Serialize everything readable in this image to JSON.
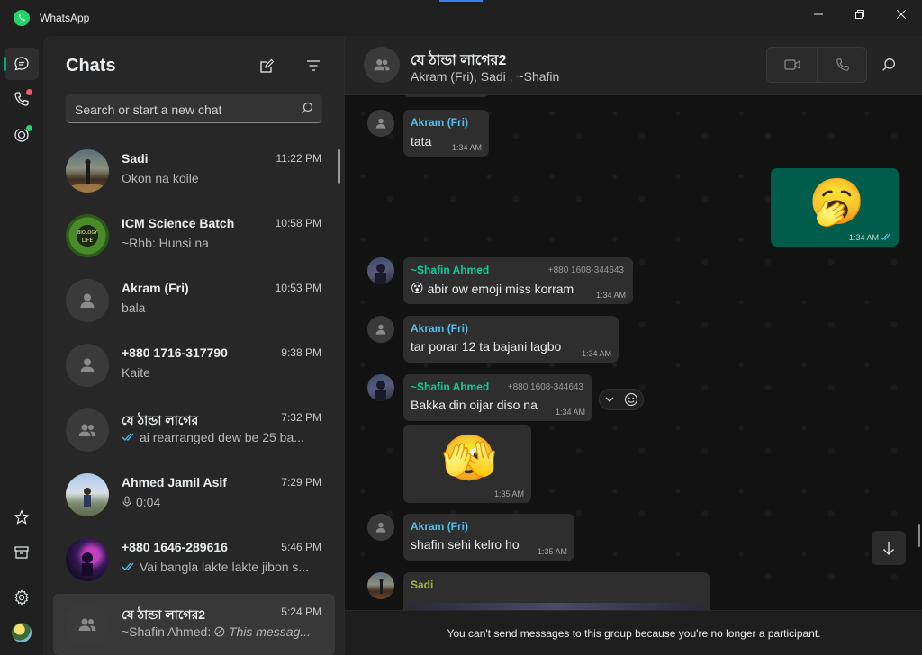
{
  "app": {
    "title": "WhatsApp"
  },
  "window": {
    "controls": [
      "minimize-icon",
      "maximize-icon",
      "close-icon"
    ]
  },
  "rail": {
    "items": [
      {
        "name": "chats",
        "icon": "chat-icon",
        "active": true
      },
      {
        "name": "calls",
        "icon": "phone-icon",
        "badge_color": "#f15c6d"
      },
      {
        "name": "status",
        "icon": "status-icon",
        "badge_color": "#25d366"
      }
    ],
    "bottom": [
      {
        "name": "starred",
        "icon": "star-icon"
      },
      {
        "name": "archived",
        "icon": "archive-icon"
      },
      {
        "name": "settings",
        "icon": "gear-icon"
      },
      {
        "name": "profile",
        "icon": "avatar"
      }
    ]
  },
  "chatlist": {
    "title": "Chats",
    "search_placeholder": "Search or start a new chat",
    "items": [
      {
        "name": "Sadi",
        "time": "11:22 PM",
        "preview": "Okon na koile",
        "avatar": "photo"
      },
      {
        "name": "ICM Science Batch",
        "time": "10:58 PM",
        "preview": "~Rhb: Hunsi na",
        "avatar": "photo"
      },
      {
        "name": "Akram (Fri)",
        "time": "10:53 PM",
        "preview": "bala",
        "avatar": "person"
      },
      {
        "name": "+880 1716-317790",
        "time": "9:38 PM",
        "preview": "Kaite",
        "avatar": "person"
      },
      {
        "name": "যে ঠান্ডা লাগের",
        "time": "7:32 PM",
        "preview": "ai rearranged dew be 25 ba...",
        "avatar": "group",
        "ticks": true
      },
      {
        "name": "Ahmed Jamil Asif",
        "time": "7:29 PM",
        "preview": "0:04",
        "avatar": "photo",
        "voice": true
      },
      {
        "name": "+880 1646-289616",
        "time": "5:46 PM",
        "preview": "Vai bangla lakte lakte jibon s...",
        "avatar": "photo",
        "ticks": true
      },
      {
        "name": "যে ঠান্ডা লাগের2",
        "time": "5:24 PM",
        "preview_prefix": "~Shafin Ahmed:",
        "preview": "This messag...",
        "avatar": "group",
        "deleted": true,
        "selected": true
      }
    ]
  },
  "conversation": {
    "name": "যে ঠান্ডা লাগের2",
    "members": "Akram (Fri), Sadi , ~Shafin",
    "footer_notice": "You can't send messages to this group because you're no longer a participant.",
    "messages": [
      {
        "sender": "Akram (Fri)",
        "sender_color": "#53bdeb",
        "text": "tata",
        "time": "1:34 AM"
      },
      {
        "outgoing": true,
        "emoji": "🥱",
        "time": "1:34 AM"
      },
      {
        "sender": "~Shafin Ahmed",
        "sender_color": "#06cf9c",
        "phone": "+880 1608-344643",
        "text": "abir ow emoji miss korram",
        "text_emoji": "😵",
        "time": "1:34 AM"
      },
      {
        "sender": "Akram (Fri)",
        "sender_color": "#53bdeb",
        "text": "tar porar 12 ta bajani lagbo",
        "time": "1:34 AM"
      },
      {
        "sender": "~Shafin Ahmed",
        "sender_color": "#06cf9c",
        "phone": "+880 1608-344643",
        "text": "Bakka din oijar diso na",
        "time": "1:34 AM"
      },
      {
        "emoji": "🫣",
        "time": "1:35 AM"
      },
      {
        "sender": "Akram (Fri)",
        "sender_color": "#53bdeb",
        "text": "shafin sehi kelro ho",
        "time": "1:35 AM"
      },
      {
        "sender": "Sadi",
        "sender_color": "#a5b337"
      }
    ]
  },
  "colors": {
    "accent": "#00a884",
    "outgoing_bubble": "#005c4b",
    "incoming_bubble": "#2e2e2e"
  }
}
